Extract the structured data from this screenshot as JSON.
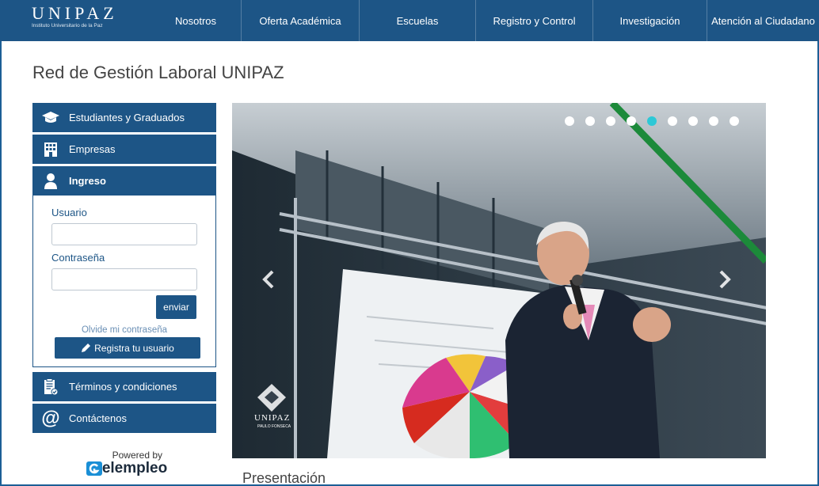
{
  "logo": {
    "title": "UNIPAZ",
    "subtitle": "Instituto Universitario de la Paz"
  },
  "nav": [
    {
      "label": "Nosotros"
    },
    {
      "label": "Oferta Académica"
    },
    {
      "label": "Escuelas"
    },
    {
      "label": "Registro y Control"
    },
    {
      "label": "Investigación"
    },
    {
      "label": "Atención al Ciudadano"
    }
  ],
  "page": {
    "title": "Red de Gestión Laboral UNIPAZ",
    "section_title": "Presentación"
  },
  "sidebar": {
    "students": "Estudiantes y Graduados",
    "companies": "Empresas",
    "login_header": "Ingreso",
    "user_label": "Usuario",
    "user_value": "",
    "password_label": "Contraseña",
    "password_value": "",
    "submit": "enviar",
    "forgot": "Olvide mi contraseña",
    "register": "Registra tu usuario",
    "terms": "Términos y condiciones",
    "contact": "Contáctenos"
  },
  "powered": {
    "label": "Powered by",
    "brand": "elempleo"
  },
  "carousel": {
    "slide_count": 9,
    "active_index": 4,
    "watermark": "UNIPAZ",
    "watermark_sub": "PAULO FONSECA"
  },
  "colors": {
    "brand": "#1d5586",
    "active_dot": "#2dc8d6"
  }
}
